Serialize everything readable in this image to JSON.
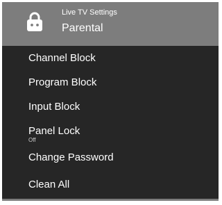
{
  "header": {
    "icon": "lock-icon",
    "subtitle": "Live TV Settings",
    "title": "Parental",
    "background_color": "#7d7d7d"
  },
  "menu": {
    "background_color": "#262626",
    "items": [
      {
        "label": "Channel Block"
      },
      {
        "label": "Program Block"
      },
      {
        "label": "Input Block"
      },
      {
        "label": "Panel Lock",
        "value": "Off"
      },
      {
        "label": "Change Password"
      },
      {
        "label": "Clean All"
      }
    ]
  }
}
